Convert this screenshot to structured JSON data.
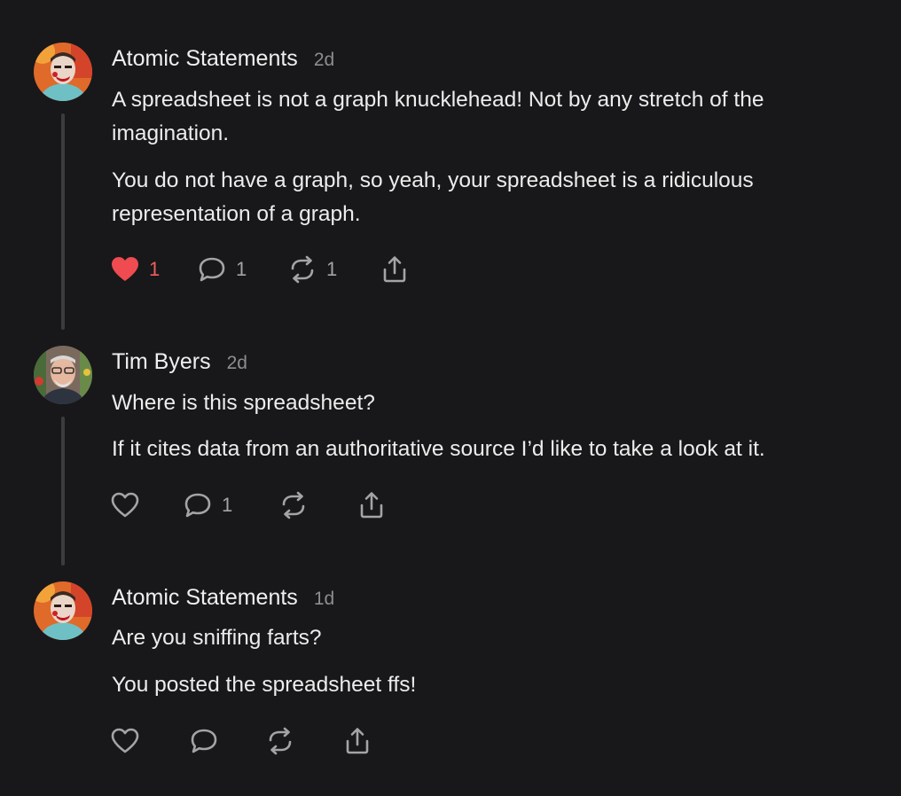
{
  "comments": [
    {
      "author": "Atomic Statements",
      "time": "2d",
      "paragraphs": [
        "A spreadsheet is not a graph knucklehead! Not by any stretch of the imagination.",
        "You do not have a graph, so yeah, your spreadsheet is a ridiculous representation of a graph."
      ],
      "actions": {
        "like": {
          "count": "1",
          "liked": true
        },
        "reply": {
          "count": "1"
        },
        "restack": {
          "count": "1"
        },
        "share": {}
      }
    },
    {
      "author": "Tim Byers",
      "time": "2d",
      "paragraphs": [
        "Where is this spreadsheet?",
        "If it cites data from an authoritative source I’d like to take a look at it."
      ],
      "actions": {
        "like": {
          "count": "",
          "liked": false
        },
        "reply": {
          "count": "1"
        },
        "restack": {
          "count": ""
        },
        "share": {}
      }
    },
    {
      "author": "Atomic Statements",
      "time": "1d",
      "paragraphs": [
        "Are you sniffing farts?",
        "You posted the spreadsheet ffs!"
      ],
      "actions": {
        "like": {
          "count": "",
          "liked": false
        },
        "reply": {
          "count": ""
        },
        "restack": {
          "count": ""
        },
        "share": {}
      }
    }
  ],
  "icons": {
    "like": "heart-icon",
    "reply": "speech-bubble-icon",
    "restack": "restack-icon",
    "share": "share-icon"
  },
  "colors": {
    "background": "#18181a",
    "text": "#ececec",
    "muted": "#8d8d92",
    "liked": "#f0605c",
    "thread_line": "#3c3c40"
  }
}
